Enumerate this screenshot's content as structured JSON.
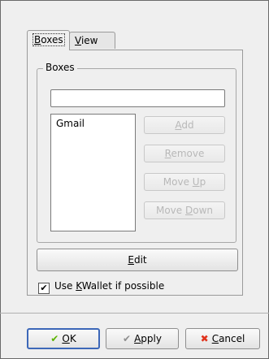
{
  "tabs": [
    {
      "label": "Boxes",
      "mnemonic_prefix": "",
      "mnemonic": "B",
      "rest": "oxes",
      "active": true
    },
    {
      "label": "View",
      "mnemonic_prefix": "",
      "mnemonic": "V",
      "rest": "iew",
      "active": false
    }
  ],
  "boxes_group": {
    "title": "Boxes",
    "input_value": "",
    "list_items": [
      "Gmail"
    ],
    "buttons": {
      "add": {
        "prefix": "",
        "mnemonic": "A",
        "rest": "dd"
      },
      "remove": {
        "prefix": "",
        "mnemonic": "R",
        "rest": "emove"
      },
      "move_up": {
        "prefix": "Move ",
        "mnemonic": "U",
        "rest": "p"
      },
      "move_down": {
        "prefix": "Move ",
        "mnemonic": "D",
        "rest": "own"
      }
    }
  },
  "edit_button": {
    "prefix": "",
    "mnemonic": "E",
    "rest": "dit"
  },
  "kwallet_checkbox": {
    "checked": true,
    "prefix": "Use ",
    "mnemonic": "K",
    "rest": "Wallet if possible"
  },
  "dialog_buttons": {
    "ok": {
      "prefix": "",
      "mnemonic": "O",
      "rest": "K",
      "icon": "check-icon"
    },
    "apply": {
      "prefix": "",
      "mnemonic": "A",
      "rest": "pply",
      "icon": "apply-check-icon"
    },
    "cancel": {
      "prefix": "",
      "mnemonic": "C",
      "rest": "ancel",
      "icon": "cancel-x-icon"
    }
  },
  "colors": {
    "ok_border": "#3c67b8",
    "check_green": "#5bb300",
    "cancel_red": "#e0321c"
  }
}
